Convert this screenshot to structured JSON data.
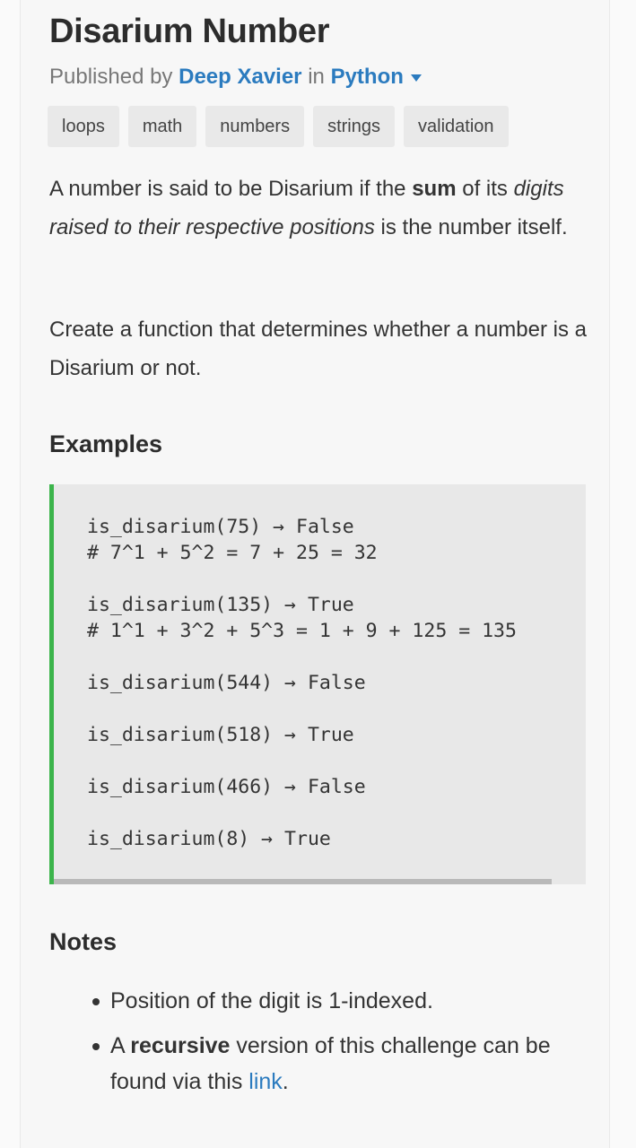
{
  "challenge": {
    "title": "Disarium Number",
    "published_by": "Published by",
    "author": "Deep Xavier",
    "in": "in",
    "language": "Python",
    "tags": [
      "loops",
      "math",
      "numbers",
      "strings",
      "validation"
    ]
  },
  "description": {
    "p1": {
      "t1": "A number is said to be Disarium if the ",
      "bold": "sum",
      "t2": " of its ",
      "italic": "digits raised to their respective positions",
      "t3": " is the number itself."
    },
    "p2": "Create a function that determines whether a number is a Disarium or not."
  },
  "examples": {
    "heading": "Examples",
    "lines": [
      "is_disarium(75) → False",
      "# 7^1 + 5^2 = 7 + 25 = 32",
      "is_disarium(135) → True",
      "# 1^1 + 3^2 + 5^3 = 1 + 9 + 125 = 135",
      "is_disarium(544) → False",
      "is_disarium(518) → True",
      "is_disarium(466) → False",
      "is_disarium(8) → True"
    ]
  },
  "notes": {
    "heading": "Notes",
    "n1": "Position of the digit is 1-indexed.",
    "n2": {
      "t1": "A ",
      "bold": "recursive",
      "t2": " version of this challenge can be found via this ",
      "link": "link",
      "t3": "."
    }
  }
}
